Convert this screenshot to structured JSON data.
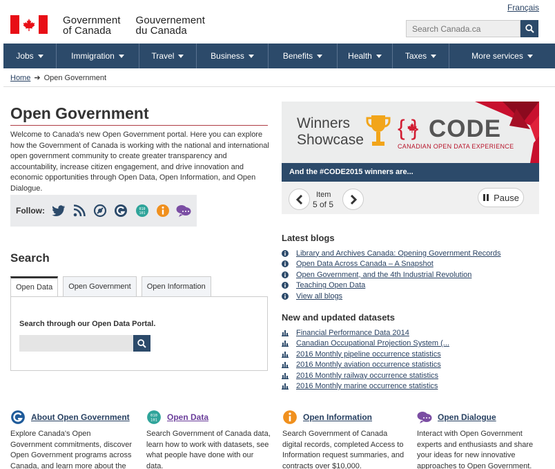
{
  "header": {
    "language_link": "Français",
    "brand_en_line1": "Government",
    "brand_en_line2": "of Canada",
    "brand_fr_line1": "Gouvernement",
    "brand_fr_line2": "du Canada",
    "search_placeholder": "Search Canada.ca"
  },
  "nav": {
    "items": [
      "Jobs",
      "Immigration",
      "Travel",
      "Business",
      "Benefits",
      "Health",
      "Taxes",
      "More services"
    ]
  },
  "breadcrumb": {
    "home": "Home",
    "current": "Open Government"
  },
  "main": {
    "title": "Open Government",
    "intro": "Welcome to Canada's new Open Government portal. Here you can explore how the Government of Canada is working with the national and international open government community to create greater transparency and accountability, increase citizen engagement, and drive innovation and economic opportunities through Open Data, Open Information, and Open Dialogue.",
    "follow_label": "Follow:"
  },
  "search": {
    "heading": "Search",
    "tabs": [
      "Open Data",
      "Open Government",
      "Open Information"
    ],
    "panel_text": "Search through our Open Data Portal."
  },
  "carousel": {
    "winners_line1": "Winners",
    "winners_line2": "Showcase",
    "code": "CODE",
    "code_sub": "CANADIAN OPEN DATA EXPERIENCE",
    "caption": "And the #CODE2015 winners are...",
    "item_label": "Item",
    "item_value": "5 of 5",
    "pause_label": "Pause"
  },
  "blogs": {
    "heading": "Latest blogs",
    "items": [
      "Library and Archives Canada: Opening Government Records",
      "Open Data Across Canada – A Snapshot",
      "Open Government, and the 4th Industrial Revolution",
      "Teaching Open Data",
      "View all blogs"
    ]
  },
  "datasets": {
    "heading": "New and updated datasets",
    "items": [
      "Financial Performance Data 2014",
      "Canadian Occupational Projection System (...",
      "2016 Monthly pipeline occurrence statistics",
      "2016 Monthly aviation occurrence statistics",
      "2016 Monthly railway occurrence statistics",
      "2016 Monthly marine occurrence statistics"
    ]
  },
  "features": [
    {
      "title": "About Open Government",
      "body": "Explore Canada's Open Government commitments, discover Open Government programs across Canada, and learn more about the",
      "icon": "open-government-icon",
      "color": "#1f5b9a"
    },
    {
      "title": "Open Data",
      "body": "Search Government of Canada data, learn how to work with datasets, see what people have done with our data.",
      "icon": "open-data-icon",
      "color": "#2fa49a"
    },
    {
      "title": "Open Information",
      "body": "Search Government of Canada digital records, completed Access to Information request summaries, and contracts over $10,000.",
      "icon": "open-information-icon",
      "color": "#f0901e"
    },
    {
      "title": "Open Dialogue",
      "body": "Interact with Open Government experts and enthusiasts and share your ideas for new innovative approaches to Open Government.",
      "icon": "open-dialogue-icon",
      "color": "#7b4ea3"
    }
  ]
}
